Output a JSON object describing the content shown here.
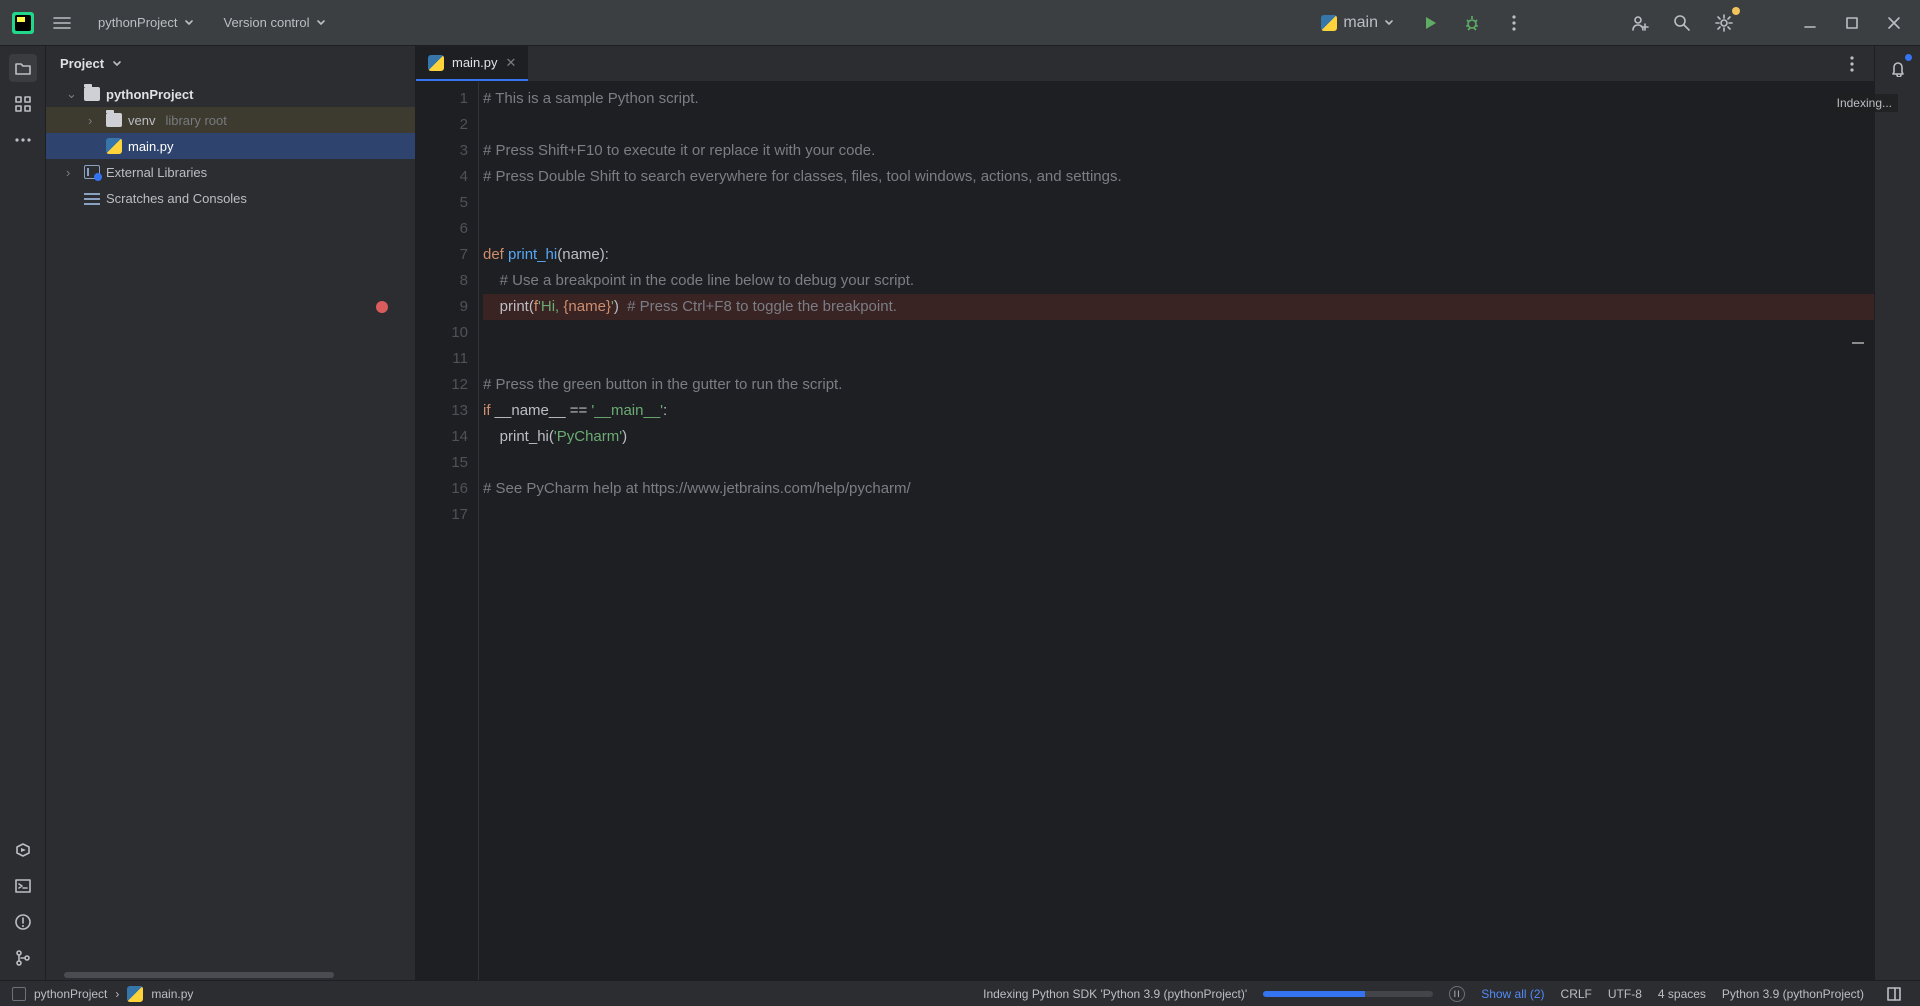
{
  "titlebar": {
    "project_name": "pythonProject",
    "vcs_label": "Version control",
    "run_config": "main"
  },
  "project_panel": {
    "title": "Project",
    "tree": {
      "root": "pythonProject",
      "venv": "venv",
      "venv_hint": "library root",
      "file": "main.py",
      "ext_libs": "External Libraries",
      "scratches": "Scratches and Consoles"
    }
  },
  "editor": {
    "tab_label": "main.py",
    "indexing_label": "Indexing...",
    "code_lines": [
      {
        "n": 1,
        "cls": "c",
        "text": "# This is a sample Python script."
      },
      {
        "n": 2,
        "cls": "",
        "text": ""
      },
      {
        "n": 3,
        "cls": "c",
        "text": "# Press Shift+F10 to execute it or replace it with your code."
      },
      {
        "n": 4,
        "cls": "c",
        "text": "# Press Double Shift to search everywhere for classes, files, tool windows, actions, and settings."
      },
      {
        "n": 5,
        "cls": "",
        "text": ""
      },
      {
        "n": 6,
        "cls": "",
        "text": ""
      },
      {
        "n": 7,
        "cls": "def",
        "text": ""
      },
      {
        "n": 8,
        "cls": "c",
        "text": "    # Use a breakpoint in the code line below to debug your script."
      },
      {
        "n": 9,
        "cls": "bp",
        "text": ""
      },
      {
        "n": 10,
        "cls": "",
        "text": ""
      },
      {
        "n": 11,
        "cls": "",
        "text": ""
      },
      {
        "n": 12,
        "cls": "c",
        "text": "# Press the green button in the gutter to run the script."
      },
      {
        "n": 13,
        "cls": "if",
        "text": ""
      },
      {
        "n": 14,
        "cls": "call",
        "text": ""
      },
      {
        "n": 15,
        "cls": "",
        "text": ""
      },
      {
        "n": 16,
        "cls": "c",
        "text": "# See PyCharm help at https://www.jetbrains.com/help/pycharm/"
      },
      {
        "n": 17,
        "cls": "",
        "text": ""
      }
    ],
    "line7": {
      "kw": "def ",
      "fn": "print_hi",
      "rest": "(name):"
    },
    "line9": {
      "indent": "    ",
      "call": "print(",
      "f": "f",
      "s1": "'Hi, ",
      "br": "{name}",
      "s2": "'",
      "close": ")",
      "pad": "  ",
      "cmt": "# Press Ctrl+F8 to toggle the breakpoint."
    },
    "line13": {
      "kw": "if ",
      "dunder": "__name__",
      "eq": " == ",
      "s": "'__main__'",
      "colon": ":"
    },
    "line14": {
      "indent": "    ",
      "call": "print_hi(",
      "s": "'PyCharm'",
      "close": ")"
    }
  },
  "statusbar": {
    "crumb_project": "pythonProject",
    "crumb_file": "main.py",
    "indexing_text": "Indexing Python SDK 'Python 3.9 (pythonProject)'",
    "show_all": "Show all (2)",
    "eol": "CRLF",
    "encoding": "UTF-8",
    "indent": "4 spaces",
    "interpreter": "Python 3.9 (pythonProject)"
  }
}
